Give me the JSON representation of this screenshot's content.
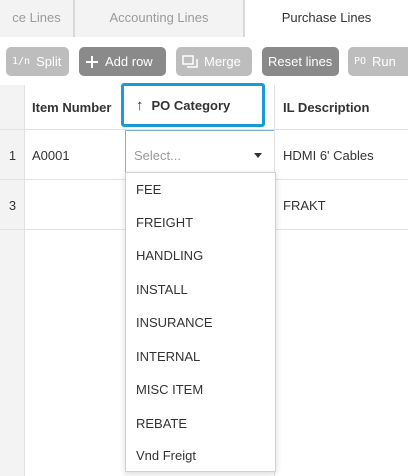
{
  "tabs": [
    {
      "label": "ce Lines",
      "active": false
    },
    {
      "label": "Accounting Lines",
      "active": false
    },
    {
      "label": "Purchase Lines",
      "active": true
    }
  ],
  "toolbar": {
    "split": {
      "icon": "1/n",
      "label": "Split"
    },
    "add_row": {
      "icon": "plus-icon",
      "label": "Add row"
    },
    "merge": {
      "icon": "merge-icon",
      "label": "Merge"
    },
    "reset": {
      "label": "Reset lines"
    },
    "run": {
      "icon": "PO",
      "label": "Run"
    }
  },
  "grid": {
    "columns": [
      "Item Number",
      "PO Category",
      "IL Description"
    ],
    "sort_arrow": "↑",
    "rows": [
      {
        "num": "1",
        "item_number": "A0001",
        "po_category": "",
        "description": "HDMI 6' Cables"
      },
      {
        "num": "3",
        "item_number": "",
        "po_category": "",
        "description": "FRAKT"
      }
    ]
  },
  "select": {
    "placeholder": "Select..."
  },
  "dropdown": {
    "options": [
      "FEE",
      "FREIGHT",
      "HANDLING",
      "INSTALL",
      "INSURANCE",
      "INTERNAL",
      "MISC ITEM",
      "REBATE",
      "Vnd Freigt"
    ]
  },
  "colors": {
    "focus_border": "#1a9bd7",
    "button_gray": "#a6a6a6"
  }
}
